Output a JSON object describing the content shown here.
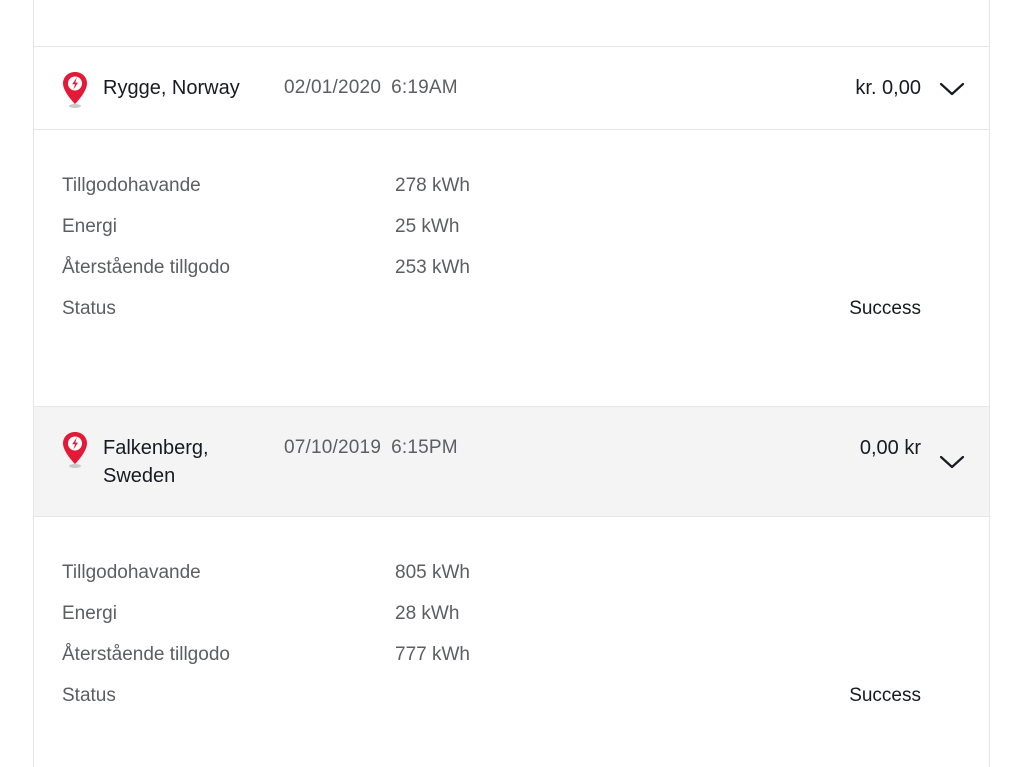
{
  "colors": {
    "pin_red": "#e31937",
    "text_primary": "#171a20",
    "text_secondary": "#5c5e62",
    "header_active_bg": "#f4f4f4",
    "divider": "#e6e6e6"
  },
  "sessions": [
    {
      "icon": "supercharger-pin-icon",
      "location": "Rygge, Norway",
      "date": "02/01/2020",
      "time": "6:19AM",
      "amount": "kr. 0,00",
      "expand_icon": "chevron-down-icon",
      "details": {
        "balance_label": "Tillgodohavande",
        "balance_value": "278 kWh",
        "energy_label": "Energi",
        "energy_value": "25 kWh",
        "remaining_label": "Återstående tillgodo",
        "remaining_value": "253 kWh",
        "status_label": "Status",
        "status_value": "Success"
      }
    },
    {
      "icon": "supercharger-pin-icon",
      "location": "Falkenberg, Sweden",
      "date": "07/10/2019",
      "time": "6:15PM",
      "amount": "0,00 kr",
      "expand_icon": "chevron-down-icon",
      "details": {
        "balance_label": "Tillgodohavande",
        "balance_value": "805 kWh",
        "energy_label": "Energi",
        "energy_value": "28 kWh",
        "remaining_label": "Återstående tillgodo",
        "remaining_value": "777 kWh",
        "status_label": "Status",
        "status_value": "Success"
      }
    }
  ]
}
